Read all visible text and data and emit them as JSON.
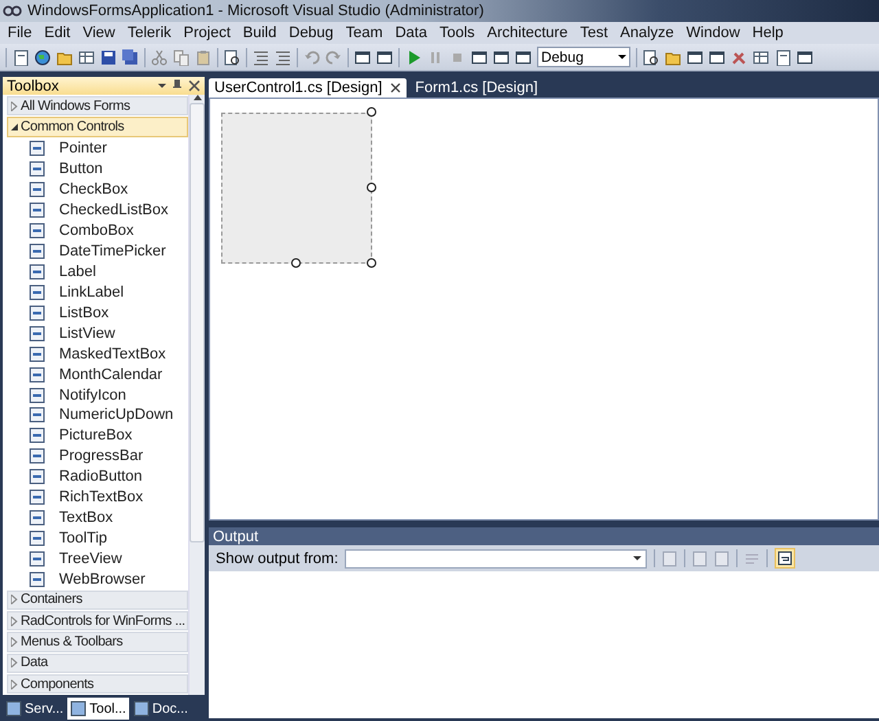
{
  "window": {
    "title": "WindowsFormsApplication1 - Microsoft Visual Studio (Administrator)"
  },
  "menu": [
    "File",
    "Edit",
    "View",
    "Telerik",
    "Project",
    "Build",
    "Debug",
    "Team",
    "Data",
    "Tools",
    "Architecture",
    "Test",
    "Analyze",
    "Window",
    "Help"
  ],
  "toolbar": {
    "configuration": "Debug"
  },
  "toolbox": {
    "title": "Toolbox",
    "groups": [
      {
        "label": "All Windows Forms",
        "expanded": false,
        "selected": false
      },
      {
        "label": "Common Controls",
        "expanded": true,
        "selected": true,
        "items": [
          "Pointer",
          "Button",
          "CheckBox",
          "CheckedListBox",
          "ComboBox",
          "DateTimePicker",
          "Label",
          "LinkLabel",
          "ListBox",
          "ListView",
          "MaskedTextBox",
          "MonthCalendar",
          "NotifyIcon",
          "NumericUpDown",
          "PictureBox",
          "ProgressBar",
          "RadioButton",
          "RichTextBox",
          "TextBox",
          "ToolTip",
          "TreeView",
          "WebBrowser"
        ]
      },
      {
        "label": "Containers",
        "expanded": false,
        "selected": false
      },
      {
        "label": "RadControls for WinForms ...",
        "expanded": false,
        "selected": false
      },
      {
        "label": "Menus & Toolbars",
        "expanded": false,
        "selected": false
      },
      {
        "label": "Data",
        "expanded": false,
        "selected": false
      },
      {
        "label": "Components",
        "expanded": false,
        "selected": false
      }
    ]
  },
  "bottom_tabs": [
    {
      "label": "Serv...",
      "selected": false
    },
    {
      "label": "Tool...",
      "selected": true
    },
    {
      "label": "Doc...",
      "selected": false
    }
  ],
  "document_tabs": [
    {
      "label": "UserControl1.cs [Design]",
      "selected": true
    },
    {
      "label": "Form1.cs [Design]",
      "selected": false
    }
  ],
  "output": {
    "title": "Output",
    "source_label": "Show output from:"
  }
}
